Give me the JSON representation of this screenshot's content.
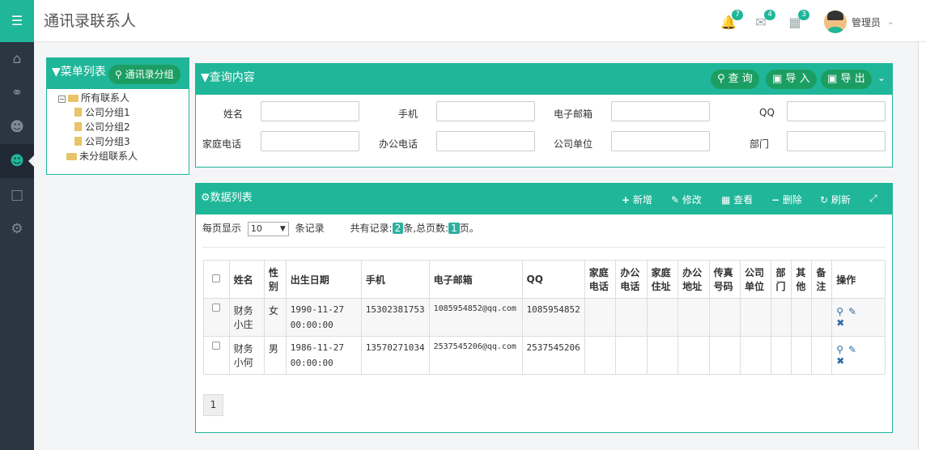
{
  "header": {
    "title": "通讯录联系人",
    "notifications": [
      {
        "icon": "bell-icon",
        "count": "7"
      },
      {
        "icon": "mail-icon",
        "count": "4"
      },
      {
        "icon": "calendar-icon",
        "count": "3"
      }
    ],
    "user": {
      "name": "管理员"
    }
  },
  "sidebar_icons": [
    "home-icon",
    "globe-icon",
    "users-icon",
    "contacts-icon",
    "lock-icon",
    "settings-icon"
  ],
  "menu_panel": {
    "title": "菜单列表",
    "group_button": "通讯录分组",
    "tree": {
      "root": "所有联系人",
      "children": [
        "公司分组1",
        "公司分组2",
        "公司分组3"
      ],
      "ungrouped": "未分组联系人"
    }
  },
  "query_panel": {
    "title": "查询内容",
    "buttons": {
      "search": "查 询",
      "import": "导 入",
      "export": "导 出"
    },
    "fields": {
      "name": "姓名",
      "mobile": "手机",
      "email": "电子邮箱",
      "qq": "QQ",
      "home_phone": "家庭电话",
      "office_phone": "办公电话",
      "company": "公司单位",
      "department": "部门"
    }
  },
  "data_panel": {
    "title": "数据列表",
    "toolbar": {
      "add": "新增",
      "edit": "修改",
      "view": "查看",
      "delete": "删除",
      "refresh": "刷新"
    },
    "page_size_label": "每页显示",
    "page_size_value": "10",
    "records_suffix": "条记录",
    "total_records_label": "共有记录:",
    "total_records": "2",
    "total_records_unit": "条,总页数:",
    "total_pages": "1",
    "total_pages_unit": "页。",
    "columns": [
      "姓名",
      "性别",
      "出生日期",
      "手机",
      "电子邮箱",
      "QQ",
      "家庭电话",
      "办公电话",
      "家庭住址",
      "办公地址",
      "传真号码",
      "公司单位",
      "部门",
      "其他",
      "备注",
      "操作"
    ],
    "rows": [
      {
        "name": "财务小庄",
        "gender": "女",
        "birth": "1990-11-27 00:00:00",
        "mobile": "15302381753",
        "email": "1085954852@qq.com",
        "qq": "1085954852"
      },
      {
        "name": "财务小何",
        "gender": "男",
        "birth": "1986-11-27 00:00:00",
        "mobile": "13570271034",
        "email": "2537545206@qq.com",
        "qq": "2537545206"
      }
    ],
    "pager": [
      "1"
    ]
  }
}
